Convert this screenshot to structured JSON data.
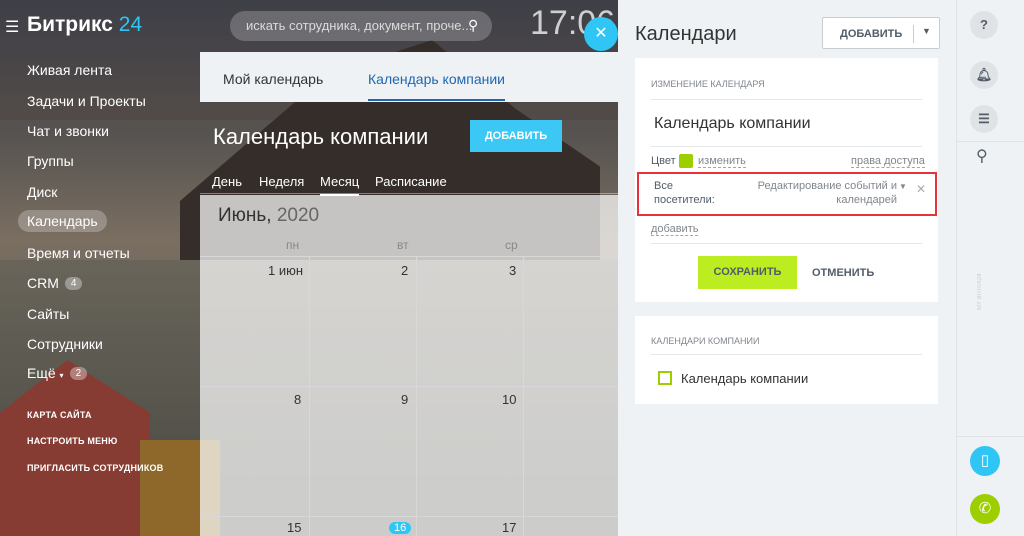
{
  "header": {
    "logo_main": "Битрикс",
    "logo_num": "24",
    "search_placeholder": "искать сотрудника, документ, проче...",
    "clock": "17:06"
  },
  "menu": {
    "items": [
      {
        "label": "Живая лента"
      },
      {
        "label": "Задачи и Проекты"
      },
      {
        "label": "Чат и звонки"
      },
      {
        "label": "Группы"
      },
      {
        "label": "Диск"
      },
      {
        "label": "Календарь"
      },
      {
        "label": "Время и отчеты"
      },
      {
        "label": "CRM",
        "badge": "4"
      },
      {
        "label": "Сайты"
      },
      {
        "label": "Сотрудники"
      },
      {
        "label": "Ещё",
        "badge": "2"
      }
    ],
    "site_map": "КАРТА САЙТА",
    "configure": "НАСТРОИТЬ МЕНЮ",
    "invite": "ПРИГЛАСИТЬ СОТРУДНИКОВ"
  },
  "calendar": {
    "tabs": [
      "Мой календарь",
      "Календарь компании"
    ],
    "title": "Календарь компании",
    "add_label": "ДОБАВИТЬ",
    "views": [
      "День",
      "Неделя",
      "Месяц",
      "Расписание"
    ],
    "month": "Июнь,",
    "year": "2020",
    "weekdays": [
      "пн",
      "вт",
      "ср"
    ],
    "week1": [
      "1 июн",
      "2",
      "3"
    ],
    "week2": [
      "8",
      "9",
      "10"
    ],
    "week3": [
      "15",
      "16",
      "17"
    ]
  },
  "panel": {
    "title": "Календари",
    "add_label": "ДОБАВИТЬ",
    "edit_section": "ИЗМЕНЕНИЕ КАЛЕНДАРЯ",
    "calendar_name": "Календарь компании",
    "color_label": "Цвет",
    "change_link": "изменить",
    "access_link": "права доступа",
    "access_who_1": "Все",
    "access_who_2": "посетители:",
    "access_rights_1": "Редактирование событий и",
    "access_rights_2": "календарей",
    "add_link": "добавить",
    "save_label": "СОХРАНИТЬ",
    "cancel_label": "ОТМЕНИТЬ",
    "company_section": "КАЛЕНДАРИ КОМПАНИИ",
    "company_item": "Календарь компании",
    "color": "#9dcf00"
  },
  "rightbar": {
    "help": "?",
    "vertical_text": "MY BITRIX24"
  }
}
